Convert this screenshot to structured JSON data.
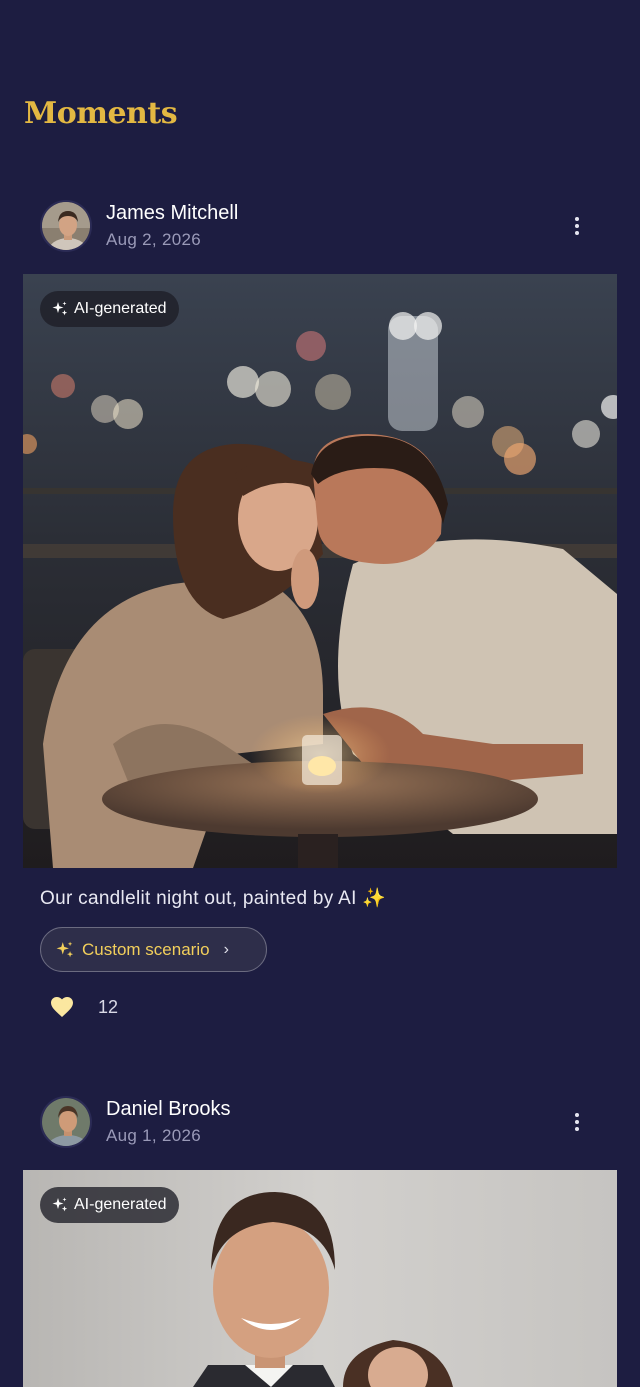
{
  "header": {
    "title": "Moments"
  },
  "colors": {
    "background": "#1d1d41",
    "accent": "#e3b842",
    "chip_text": "#f2cf5b",
    "heart": "#fbe7a0"
  },
  "posts": [
    {
      "author": "James Mitchell",
      "date": "Aug 2, 2026",
      "badge": "AI-generated",
      "caption": "Our candlelit night out, painted by AI ✨",
      "chip_label": "Custom scenario",
      "chip_icon": "sparkles-icon",
      "like_icon": "heart-icon",
      "likes": "12"
    },
    {
      "author": "Daniel Brooks",
      "date": "Aug 1, 2026",
      "badge": "AI-generated"
    }
  ]
}
